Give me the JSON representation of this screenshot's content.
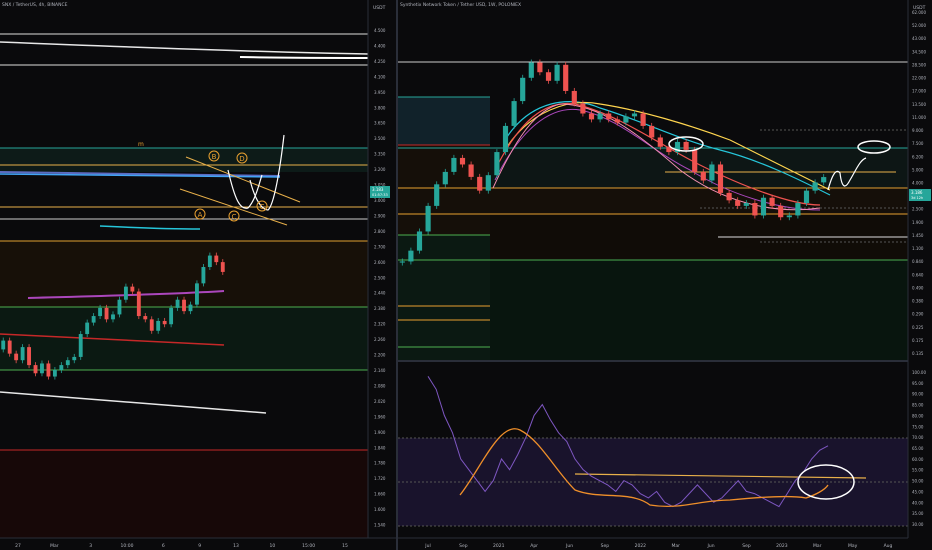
{
  "left_panel": {
    "title": "SNX / TetherUS, 4h, BINANCE",
    "currency": "USDT",
    "price_badge": "3.183",
    "price_badge_sub": "01:57:33",
    "floating_label": "m",
    "wave_labels": [
      "B",
      "D",
      "A",
      "C",
      "C"
    ],
    "price_ticks": [
      "4.500",
      "4.400",
      "4.250",
      "4.100",
      "3.950",
      "3.800",
      "3.650",
      "3.500",
      "3.350",
      "3.200",
      "3.050",
      "3.000",
      "2.900",
      "2.800",
      "2.700",
      "2.600",
      "2.500",
      "2.440",
      "2.380",
      "2.320",
      "2.260",
      "2.200",
      "2.140",
      "2.080",
      "2.020",
      "1.960",
      "1.900",
      "1.840",
      "1.780",
      "1.720",
      "1.660",
      "1.600",
      "1.540",
      "1.480"
    ],
    "time_ticks": [
      "27",
      "Mar",
      "3",
      "10:00",
      "6",
      "9",
      "13",
      "10",
      "15:00",
      "15"
    ]
  },
  "right_panel": {
    "title": "Synthetix Network Token / Tether USD, 1W, POLONIEX",
    "currency": "USDT",
    "price_badge": "3.186",
    "price_badge_sub": "3d 12h",
    "price_ticks": [
      "62.000",
      "52.000",
      "43.000",
      "34.500",
      "28.500",
      "22.000",
      "17.000",
      "13.500",
      "11.000",
      "9.000",
      "7.500",
      "6.200",
      "5.000",
      "4.000",
      "3.200",
      "2.500",
      "1.900",
      "1.450",
      "1.100",
      "0.840",
      "0.640",
      "0.490",
      "0.380",
      "0.290",
      "0.225",
      "0.175",
      "0.135"
    ],
    "rsi_ticks": [
      "100.00",
      "95.00",
      "90.00",
      "85.00",
      "80.00",
      "75.00",
      "70.00",
      "65.00",
      "60.00",
      "55.00",
      "50.00",
      "45.00",
      "40.00",
      "35.00",
      "30.00"
    ],
    "time_ticks": [
      "Jul",
      "Sep",
      "2021",
      "Apr",
      "Jun",
      "Sep",
      "2022",
      "Mar",
      "Jun",
      "Sep",
      "2023",
      "Mar",
      "May",
      "Aug"
    ]
  },
  "chart_data": [
    {
      "type": "candlestick",
      "title": "SNX / TetherUS, 4h, BINANCE",
      "ylabel": "USDT",
      "ylim": [
        1.48,
        4.6
      ],
      "close": [
        2.7,
        2.62,
        2.58,
        2.66,
        2.55,
        2.5,
        2.56,
        2.48,
        2.52,
        2.55,
        2.58,
        2.6,
        2.74,
        2.81,
        2.85,
        2.9,
        2.83,
        2.86,
        2.95,
        3.03,
        3.0,
        2.85,
        2.83,
        2.76,
        2.82,
        2.8,
        2.9,
        2.95,
        2.88,
        2.92,
        3.05,
        3.15,
        3.22,
        3.18,
        3.12
      ]
    },
    {
      "type": "candlestick",
      "title": "Synthetix Network Token / Tether USD, 1W, POLONIEX",
      "ylabel": "USDT",
      "scale": "log",
      "ylim": [
        0.135,
        62
      ],
      "close": [
        0.7,
        0.85,
        1.2,
        1.9,
        2.8,
        3.5,
        4.5,
        4.0,
        3.2,
        2.5,
        3.3,
        5.0,
        8.0,
        12.5,
        19,
        25,
        21,
        18,
        24,
        15,
        12,
        10,
        9,
        10,
        9,
        8.5,
        9.5,
        10,
        8,
        6.5,
        5.5,
        5.0,
        6.0,
        5.2,
        3.5,
        3.0,
        4.0,
        2.4,
        2.1,
        1.9,
        2.0,
        1.6,
        2.2,
        1.9,
        1.55,
        1.6,
        2.0,
        2.5,
        2.9,
        3.19
      ]
    },
    {
      "type": "line",
      "title": "RSI",
      "ylim": [
        30,
        100
      ],
      "values": [
        98,
        92,
        80,
        72,
        60,
        55,
        50,
        45,
        50,
        60,
        55,
        62,
        70,
        80,
        85,
        78,
        72,
        68,
        60,
        55,
        52,
        50,
        48,
        45,
        50,
        48,
        44,
        42,
        45,
        40,
        38,
        40,
        44,
        48,
        44,
        40,
        42,
        46,
        50,
        45,
        44,
        42,
        40,
        38,
        44,
        50,
        54,
        60,
        64,
        66
      ]
    }
  ]
}
